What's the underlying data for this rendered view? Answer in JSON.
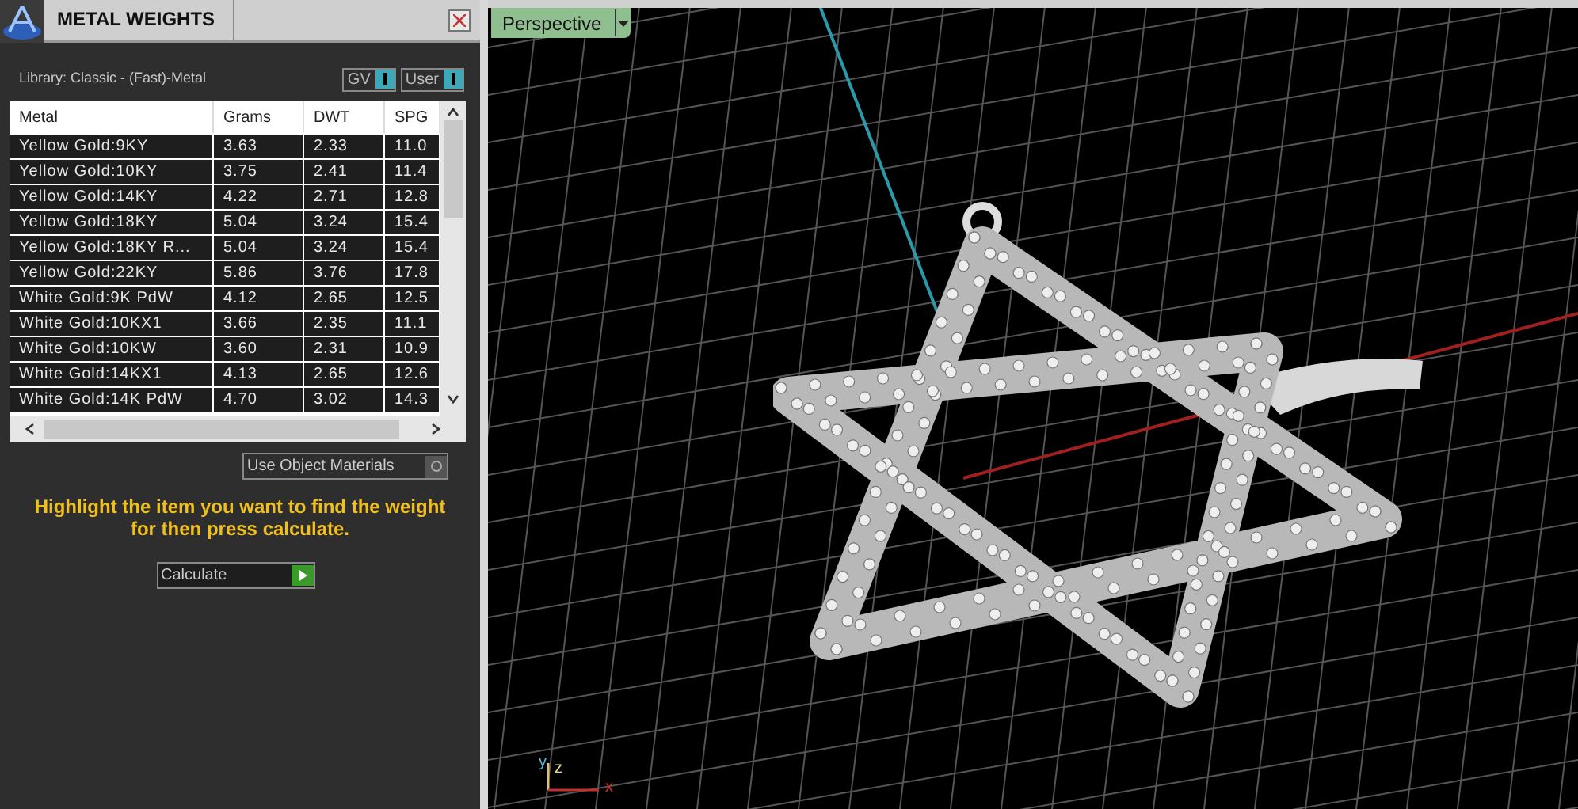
{
  "panel": {
    "title": "METAL WEIGHTS",
    "library": "Library: Classic - (Fast)-Metal",
    "toggles": [
      {
        "label": "GV",
        "on": true
      },
      {
        "label": "User",
        "on": true
      }
    ],
    "table": {
      "columns": [
        "Metal",
        "Grams",
        "DWT",
        "SPG"
      ],
      "rows": [
        {
          "cells": [
            "Yellow Gold:9KY",
            "3.63",
            "2.33",
            "11.0"
          ],
          "selected": false
        },
        {
          "cells": [
            "Yellow Gold:10KY",
            "3.75",
            "2.41",
            "11.4"
          ],
          "selected": false
        },
        {
          "cells": [
            "Yellow Gold:14KY",
            "4.22",
            "2.71",
            "12.8"
          ],
          "selected": false
        },
        {
          "cells": [
            "Yellow Gold:18KY",
            "5.04",
            "3.24",
            "15.4"
          ],
          "selected": false
        },
        {
          "cells": [
            "Yellow Gold:18KY R...",
            "5.04",
            "3.24",
            "15.4"
          ],
          "selected": false
        },
        {
          "cells": [
            "Yellow Gold:22KY",
            "5.86",
            "3.76",
            "17.8"
          ],
          "selected": false
        },
        {
          "cells": [
            "White Gold:9K PdW",
            "4.12",
            "2.65",
            "12.5"
          ],
          "selected": false
        },
        {
          "cells": [
            "White Gold:10KX1",
            "3.66",
            "2.35",
            "11.1"
          ],
          "selected": false
        },
        {
          "cells": [
            "White Gold:10KW",
            "3.60",
            "2.31",
            "10.9"
          ],
          "selected": false
        },
        {
          "cells": [
            "White Gold:14KX1",
            "4.13",
            "2.65",
            "12.6"
          ],
          "selected": false
        },
        {
          "cells": [
            "White Gold:14K PdW",
            "4.70",
            "3.02",
            "14.3"
          ],
          "selected": false
        }
      ]
    },
    "use_object_materials": {
      "label": "Use Object Materials",
      "on": false
    },
    "hint": "Highlight the item you want to find the weight for then press calculate.",
    "calculate_button": "Calculate"
  },
  "viewport": {
    "view_menu": "Perspective",
    "axes": [
      "y",
      "z",
      "x"
    ]
  }
}
